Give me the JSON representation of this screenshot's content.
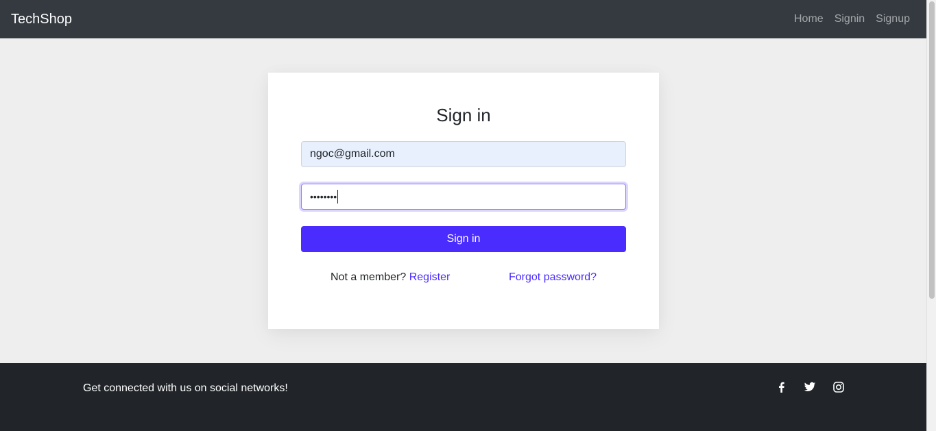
{
  "navbar": {
    "brand": "TechShop",
    "links": [
      "Home",
      "Signin",
      "Signup"
    ]
  },
  "signin_card": {
    "title": "Sign in",
    "email_value": "ngoc@gmail.com",
    "password_masked": "••••••••",
    "submit_label": "Sign in",
    "not_member_text": "Not a member?",
    "register_label": "Register",
    "forgot_label": "Forgot password?"
  },
  "footer": {
    "tagline": "Get connected with us on social networks!",
    "social_icons": [
      "facebook-icon",
      "twitter-icon",
      "instagram-icon"
    ]
  },
  "colors": {
    "navbar_bg": "#343a40",
    "footer_bg": "#212529",
    "accent": "#4a2cff",
    "page_bg": "#eeeeee",
    "autofill_bg": "#e8f0fe"
  }
}
